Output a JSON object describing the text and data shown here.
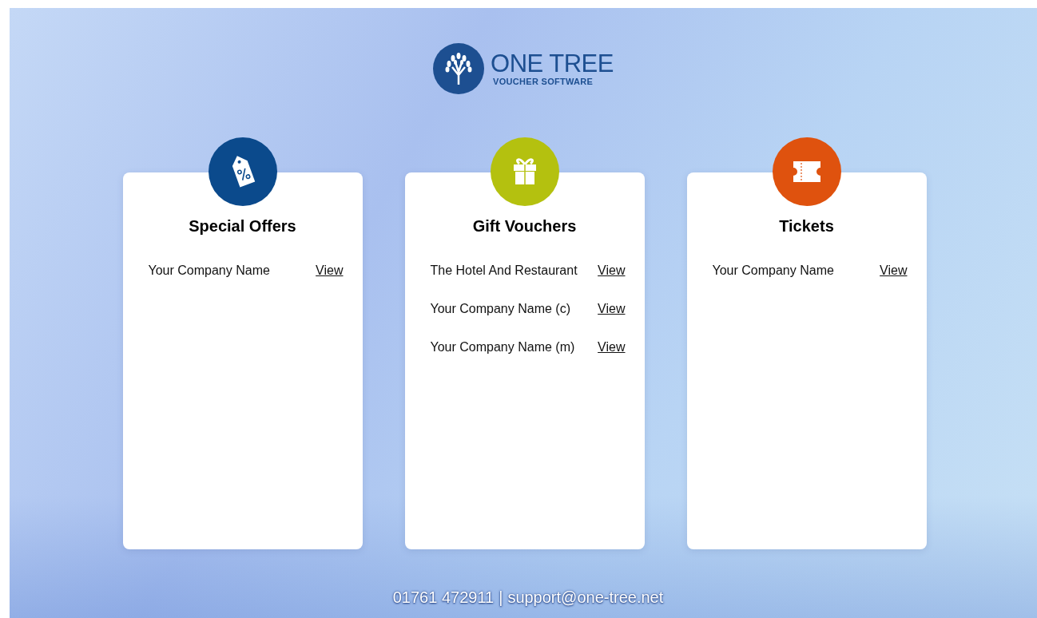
{
  "logo": {
    "title": "ONE TREE",
    "subtitle": "VOUCHER SOFTWARE"
  },
  "cards": [
    {
      "kind": "offers",
      "color": "#0b4a8c",
      "title": "Special Offers",
      "items": [
        {
          "name": "Your Company Name",
          "link": "View"
        }
      ]
    },
    {
      "kind": "gift",
      "color": "#b4c10f",
      "title": "Gift Vouchers",
      "items": [
        {
          "name": "The Hotel And Restaurant",
          "link": "View"
        },
        {
          "name": "Your Company Name (c)",
          "link": "View"
        },
        {
          "name": "Your Company Name (m)",
          "link": "View"
        }
      ]
    },
    {
      "kind": "tickets",
      "color": "#df520e",
      "title": "Tickets",
      "items": [
        {
          "name": "Your Company Name",
          "link": "View"
        }
      ]
    }
  ],
  "footer": {
    "phone": "01761 472911",
    "separator": "|",
    "email": "support@one-tree.net"
  }
}
